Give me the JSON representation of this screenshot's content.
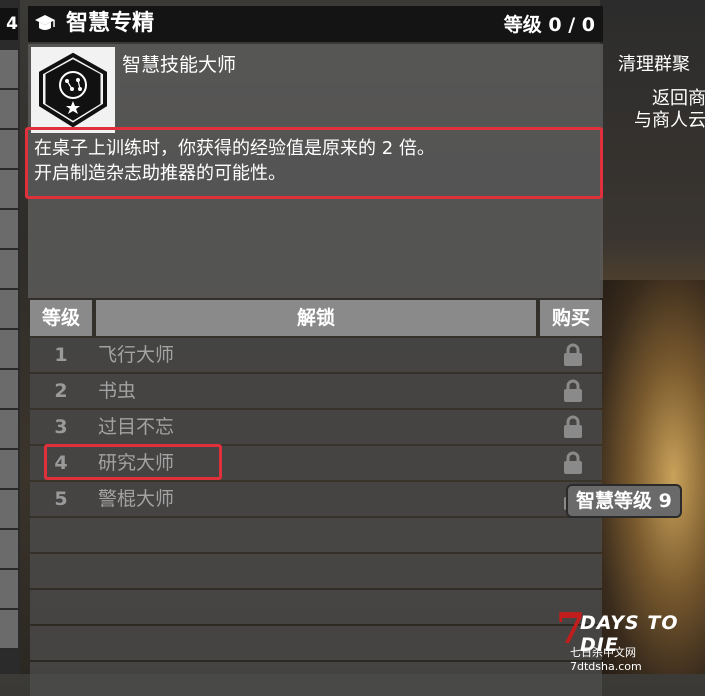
{
  "left_stub": {
    "top_number": "4"
  },
  "header": {
    "title": "智慧专精",
    "level": "等级 0 / 0"
  },
  "skill": {
    "name": "智慧技能大师",
    "description": [
      "在桌子上训练时，你获得的经验值是原来的 2 倍。",
      "开启制造杂志助推器的可能性。"
    ]
  },
  "table": {
    "col_level": "等级",
    "col_unlock": "解锁",
    "col_buy": "购买",
    "rows": [
      {
        "num": "1",
        "name": "飞行大师"
      },
      {
        "num": "2",
        "name": "书虫"
      },
      {
        "num": "3",
        "name": "过目不忘"
      },
      {
        "num": "4",
        "name": "研究大师"
      },
      {
        "num": "5",
        "name": "警棍大师"
      }
    ]
  },
  "tooltip": "智慧等级 9",
  "right_panel": {
    "line1": "清理群聚",
    "line2": "返回商",
    "line3": "与商人云"
  },
  "watermark": {
    "title": "DAYS TO DIE",
    "subtitle": "七日杀中文网 7dtdsha.com",
    "numeral": "7"
  },
  "colors": {
    "highlight": "#e0303c",
    "header_bg": "#141414",
    "column_header": "#8a8a8a"
  }
}
